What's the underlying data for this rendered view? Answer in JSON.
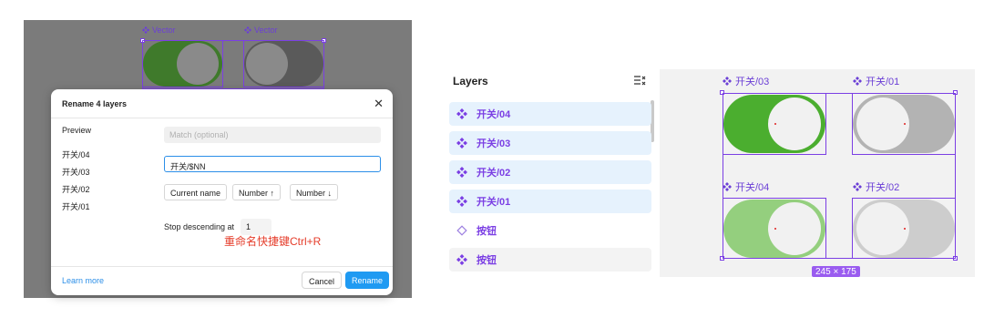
{
  "left_canvas": {
    "vector_labels": [
      "Vector",
      "Vector"
    ]
  },
  "dialog": {
    "title": "Rename 4 layers",
    "preview_heading": "Preview",
    "preview_items": [
      "开关/04",
      "开关/03",
      "开关/02",
      "开关/01"
    ],
    "match_placeholder": "Match (optional)",
    "rename_value": "开关/$NN",
    "buttons": {
      "current_name": "Current name",
      "number_up": "Number ↑",
      "number_down": "Number ↓",
      "stop_desc_label": "Stop descending at",
      "stop_desc_value": "1",
      "learn_more": "Learn more",
      "cancel": "Cancel",
      "rename": "Rename"
    },
    "annotation": "重命名快捷键Ctrl+R"
  },
  "layers_panel": {
    "title": "Layers",
    "items": [
      {
        "label": "开关/04",
        "icon": "component-instance-icon",
        "selected": true
      },
      {
        "label": "开关/03",
        "icon": "component-instance-icon",
        "selected": true
      },
      {
        "label": "开关/02",
        "icon": "component-instance-icon",
        "selected": true
      },
      {
        "label": "开关/01",
        "icon": "component-instance-icon",
        "selected": true
      },
      {
        "label": "按钮",
        "icon": "component-outline-icon",
        "selected": false
      },
      {
        "label": "按钮",
        "icon": "component-instance-icon",
        "selected": false
      }
    ]
  },
  "right_canvas": {
    "component_labels": [
      "开关/03",
      "开关/01",
      "开关/04",
      "开关/02"
    ],
    "dimension_badge": "245 × 175",
    "colors": {
      "on_green": "#4bae2f",
      "on_green_light": "#94cf7e",
      "off_gray": "#b3b3b3",
      "off_gray_light": "#cdcdcd",
      "selection": "#7b3fe4"
    }
  }
}
